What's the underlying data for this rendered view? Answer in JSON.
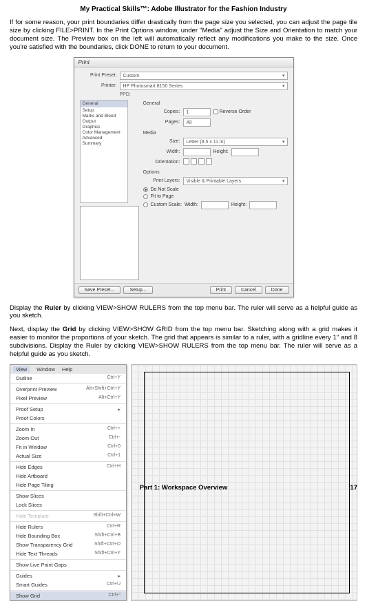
{
  "title": "My Practical Skills™: Adobe Illustrator for the Fashion Industry",
  "para1": {
    "a": "If for some reason, your print boundaries differ drastically from the page size you selected, you can adjust the page tile size by clicking FILE>PRINT. In the Print Options window, under \"Media\" adjust the Size and Orientation to match your document size. The Preview box on the left will automatically reflect any modifications you make to the size. Once you're satisfied with the boundaries, click DONE to return to your document."
  },
  "para2": {
    "pre": "Display the ",
    "bold": "Ruler",
    "post": " by clicking VIEW>SHOW RULERS from the top menu bar. The ruler will serve as a helpful guide as you sketch."
  },
  "para3": {
    "pre": "Next, display the ",
    "bold": "Grid",
    "post": " by clicking VIEW>SHOW GRID from the top menu bar. Sketching along with a grid makes it easier to monitor the proportions of your sketch. The grid that appears is similar to a ruler, with a gridline every 1\" and 8 subdivisions. Display the Ruler by clicking VIEW>SHOW RULERS from the top menu bar. The ruler will serve as a helpful guide as you sketch."
  },
  "dlg": {
    "title": "Print",
    "preset_lbl": "Print Preset:",
    "preset_val": "Custom",
    "printer_lbl": "Printer:",
    "printer_val": "HP Photosmart 8150 Series",
    "ppd": "PPD:",
    "sidebar": [
      "General",
      "Setup",
      "Marks and Bleed",
      "Output",
      "Graphics",
      "Color Management",
      "Advanced",
      "Summary"
    ],
    "general": "General",
    "copies_lbl": "Copies:",
    "copies_val": "1",
    "reverse": "Reverse Order",
    "pages_lbl": "Pages:",
    "pages_val": "All",
    "media": "Media",
    "size_lbl": "Size:",
    "size_val": "Letter (8.5 x 11 in)",
    "width_lbl": "Width:",
    "height_lbl": "Height:",
    "orient_lbl": "Orientation:",
    "options": "Options",
    "layers_lbl": "Print Layers:",
    "layers_val": "Visible & Printable Layers",
    "no_scale": "Do Not Scale",
    "fit": "Fit to Page",
    "custom": "Custom Scale:",
    "cw": "Width:",
    "ch": "Height:",
    "save": "Save Preset...",
    "setup": "Setup...",
    "print": "Print",
    "cancel": "Cancel",
    "done": "Done"
  },
  "menu": {
    "bar": [
      "View",
      "Window",
      "Help"
    ],
    "items": [
      {
        "t": "Outline",
        "s": "Ctrl+Y"
      },
      {
        "sep": true
      },
      {
        "t": "Overprint Preview",
        "s": "Alt+Shift+Ctrl+Y"
      },
      {
        "t": "Pixel Preview",
        "s": "Alt+Ctrl+Y"
      },
      {
        "sep": true
      },
      {
        "t": "Proof Setup",
        "sub": true
      },
      {
        "t": "Proof Colors"
      },
      {
        "sep": true
      },
      {
        "t": "Zoom In",
        "s": "Ctrl++"
      },
      {
        "t": "Zoom Out",
        "s": "Ctrl+-"
      },
      {
        "t": "Fit in Window",
        "s": "Ctrl+0"
      },
      {
        "t": "Actual Size",
        "s": "Ctrl+1"
      },
      {
        "sep": true
      },
      {
        "t": "Hide Edges",
        "s": "Ctrl+H"
      },
      {
        "t": "Hide Artboard"
      },
      {
        "t": "Hide Page Tiling"
      },
      {
        "sep": true
      },
      {
        "t": "Show Slices"
      },
      {
        "t": "Lock Slices"
      },
      {
        "sep": true
      },
      {
        "t": "Hide Template",
        "s": "Shift+Ctrl+W",
        "dis": true
      },
      {
        "sep": true
      },
      {
        "t": "Hide Rulers",
        "s": "Ctrl+R"
      },
      {
        "t": "Hide Bounding Box",
        "s": "Shift+Ctrl+B"
      },
      {
        "t": "Show Transparency Grid",
        "s": "Shift+Ctrl+D"
      },
      {
        "t": "Hide Text Threads",
        "s": "Shift+Ctrl+Y"
      },
      {
        "sep": true
      },
      {
        "t": "Show Live Paint Gaps"
      },
      {
        "sep": true
      },
      {
        "t": "Guides",
        "sub": true
      },
      {
        "t": "Smart Guides",
        "s": "Ctrl+U"
      },
      {
        "sep": true
      },
      {
        "t": "Show Grid",
        "s": "Ctrl+\"",
        "hl": true
      }
    ]
  },
  "footer": {
    "label": "Part 1: Workspace Overview",
    "page": "17"
  }
}
